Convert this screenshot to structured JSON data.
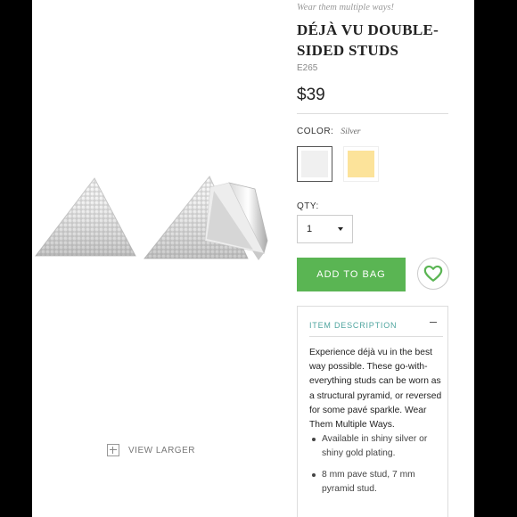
{
  "product": {
    "tagline": "Wear them multiple ways!",
    "title": "DÉJÀ VU DOUBLE-SIDED STUDS",
    "sku": "E265",
    "price": "$39"
  },
  "color": {
    "label": "COLOR:",
    "selected_value": "Silver",
    "swatches": [
      {
        "name": "Silver",
        "hex": "#f0f0f0",
        "selected": true
      },
      {
        "name": "Gold",
        "hex": "#fce39a",
        "selected": false
      }
    ]
  },
  "quantity": {
    "label": "QTY:",
    "value": "1"
  },
  "actions": {
    "add_to_bag": "ADD TO BAG",
    "accent": "#5ab553"
  },
  "description": {
    "header": "ITEM DESCRIPTION",
    "text": "Experience déjà vu in the best way possible. These go-with-everything studs can be worn as a structural pyramid, or reversed for some pavé sparkle. Wear Them Multiple Ways.",
    "bullets": [
      "Available in shiny silver or shiny gold plating.",
      "8 mm pave stud, 7 mm pyramid stud."
    ]
  },
  "image": {
    "view_larger": "VIEW LARGER"
  }
}
